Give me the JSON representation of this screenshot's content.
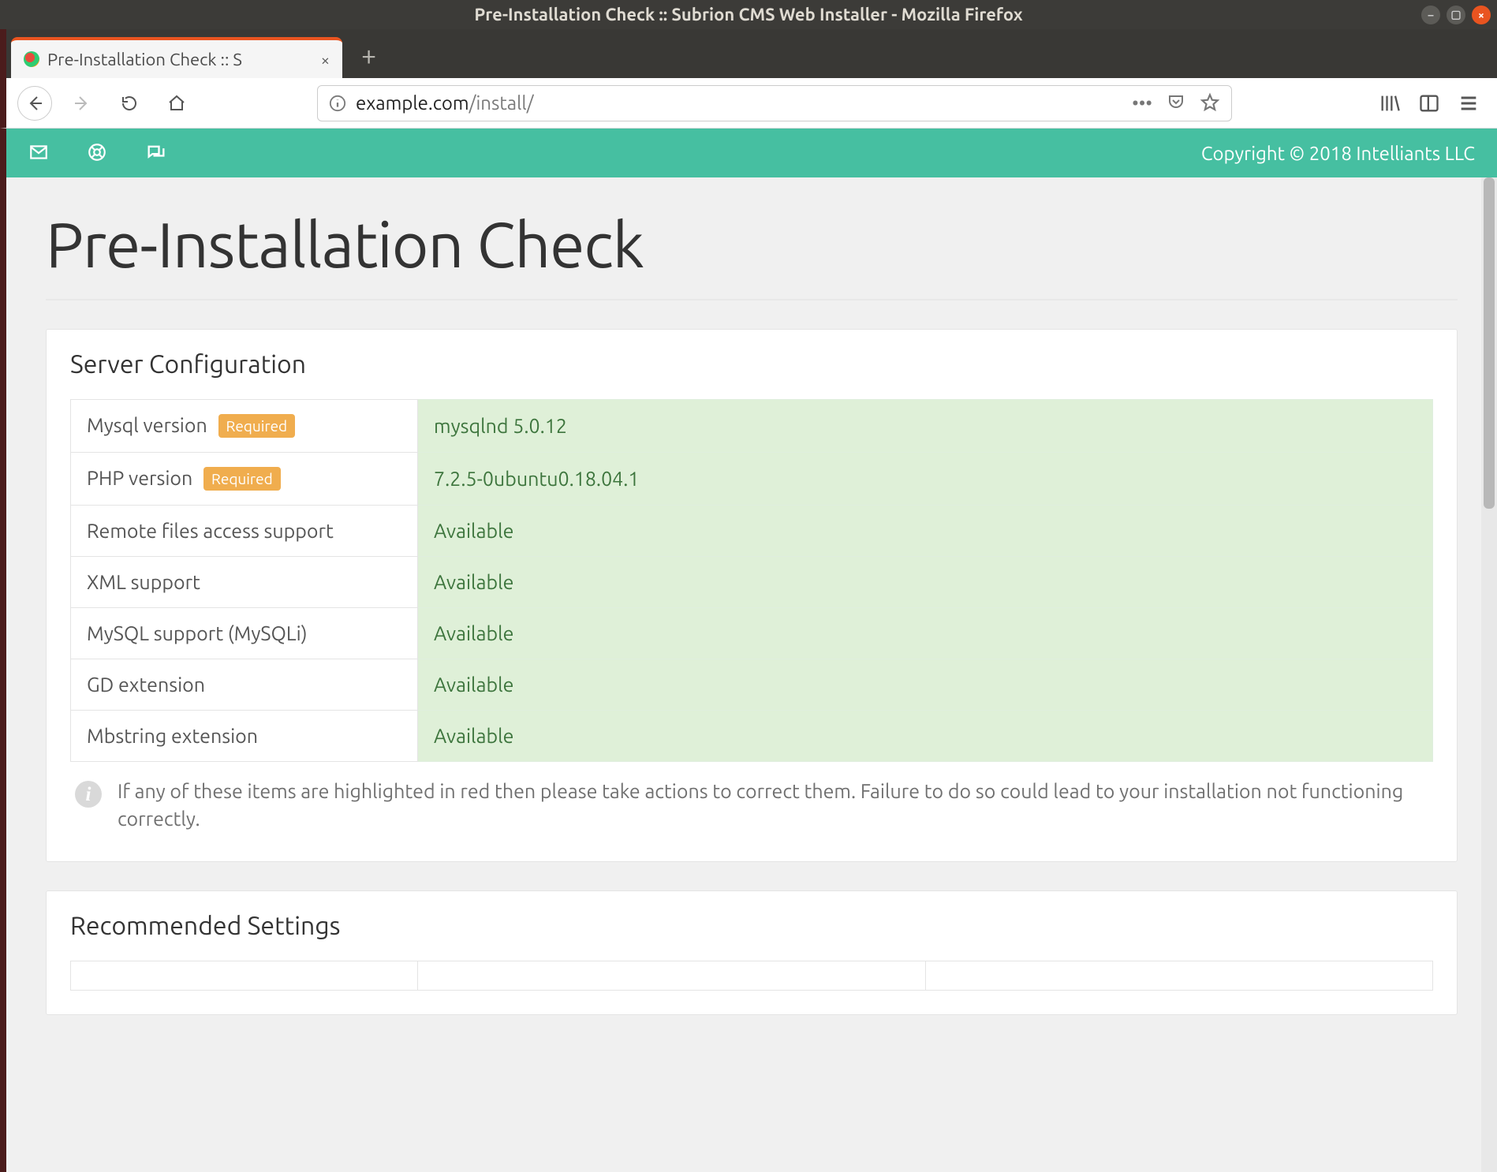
{
  "window": {
    "title": "Pre-Installation Check :: Subrion CMS Web Installer - Mozilla Firefox"
  },
  "tab": {
    "title": "Pre-Installation Check :: S"
  },
  "url": {
    "domain": "example.com",
    "path": "/install/"
  },
  "topbar": {
    "copyright": "Copyright © 2018 Intelliants LLC"
  },
  "page": {
    "title": "Pre-Installation Check"
  },
  "panel1": {
    "heading": "Server Configuration",
    "rows": [
      {
        "label": "Mysql version",
        "required": true,
        "value": "mysqlnd 5.0.12"
      },
      {
        "label": "PHP version",
        "required": true,
        "value": "7.2.5-0ubuntu0.18.04.1"
      },
      {
        "label": "Remote files access support",
        "required": false,
        "value": "Available"
      },
      {
        "label": "XML support",
        "required": false,
        "value": "Available"
      },
      {
        "label": "MySQL support (MySQLi)",
        "required": false,
        "value": "Available"
      },
      {
        "label": "GD extension",
        "required": false,
        "value": "Available"
      },
      {
        "label": "Mbstring extension",
        "required": false,
        "value": "Available"
      }
    ],
    "required_badge": "Required",
    "note": "If any of these items are highlighted in red then please take actions to correct them. Failure to do so could lead to your installation not functioning correctly."
  },
  "panel2": {
    "heading": "Recommended Settings"
  }
}
